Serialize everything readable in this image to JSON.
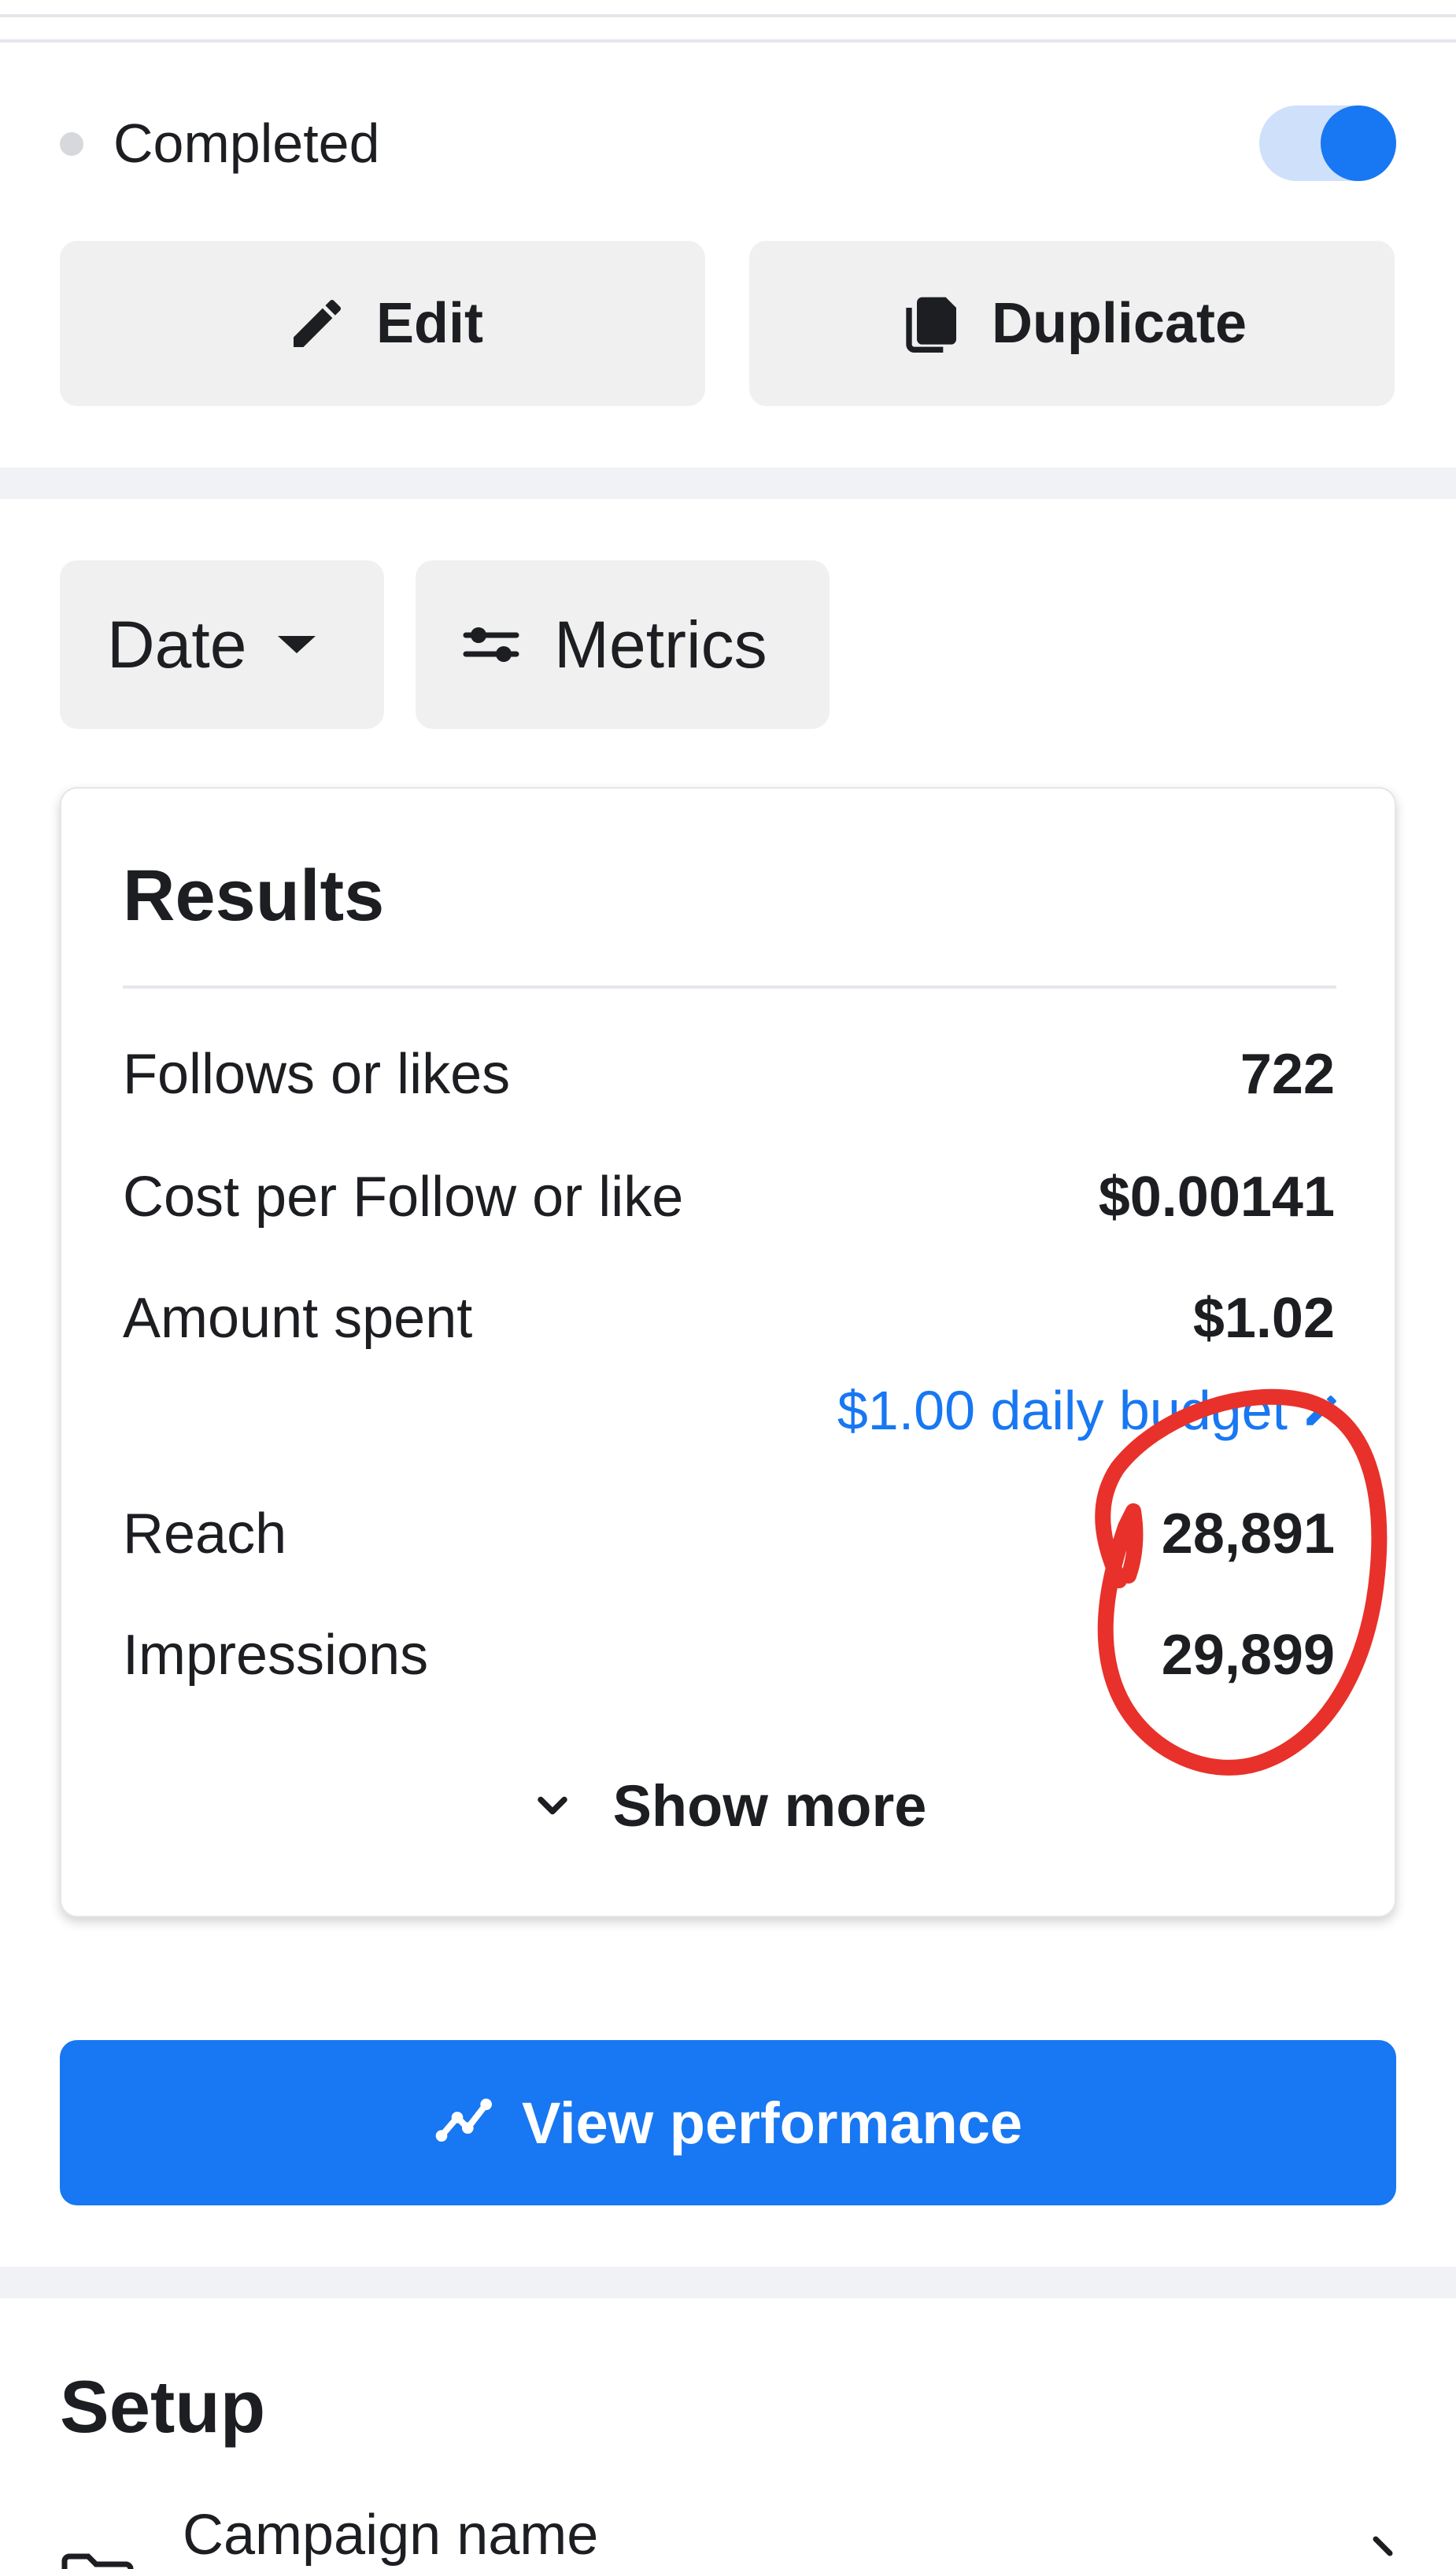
{
  "status": {
    "label": "Completed",
    "toggle_on": true,
    "accent_color": "#1877f2"
  },
  "actions": {
    "edit_label": "Edit",
    "duplicate_label": "Duplicate",
    "edit_icon": "pencil-icon",
    "duplicate_icon": "copy-icon"
  },
  "filters": {
    "date_label": "Date",
    "metrics_label": "Metrics",
    "date_icon": "caret-down-icon",
    "metrics_icon": "sliders-icon"
  },
  "results": {
    "title": "Results",
    "metrics": [
      {
        "label": "Follows or likes",
        "value": "722"
      },
      {
        "label": "Cost per Follow or like",
        "value": "$0.00141"
      },
      {
        "label": "Amount spent",
        "value": "$1.02"
      },
      {
        "label": "Reach",
        "value": "28,891"
      },
      {
        "label": "Impressions",
        "value": "29,899"
      }
    ],
    "budget_link": "$1.00 daily budget",
    "show_more": "Show more",
    "annotation_color": "#e8312a"
  },
  "view_performance": {
    "label": "View performance",
    "icon": "line-chart-icon"
  },
  "setup": {
    "title": "Setup",
    "campaign_name_label": "Campaign name"
  }
}
